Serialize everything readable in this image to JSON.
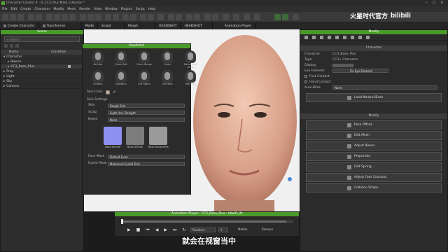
{
  "app": {
    "title": "Character Creator 4 - R_CC3_Plus Male.ccAvatar *"
  },
  "menu": [
    "File",
    "Edit",
    "Create",
    "Character",
    "Modify",
    "Mesh",
    "Render",
    "View",
    "Window",
    "Plugins",
    "Script",
    "Help"
  ],
  "subbar": {
    "create_character": "Create Character",
    "transformer": "Transformer",
    "mode": "Mode",
    "sculpt": "Sculpt",
    "morph": "Morph",
    "headshot": "HEADSHOT",
    "headshot2": "HEADSHOT",
    "animation_player": "Animation Player"
  },
  "scene": {
    "title": "Scene",
    "search_placeholder": "Search",
    "col_name": "Name",
    "col_condition": "Condition",
    "items": [
      {
        "label": "Character"
      },
      {
        "label": "Bakers"
      },
      {
        "label": "CC3_Base_Plus"
      },
      {
        "label": "Prop"
      },
      {
        "label": "Light"
      },
      {
        "label": "Sky"
      },
      {
        "label": "Camera"
      }
    ]
  },
  "headshot": {
    "title": "Headshot",
    "heads": [
      "No Hair",
      "Clean Soft",
      "Clean Rough",
      "Scalp",
      "Beard and Scalp",
      "Contour",
      "Sideburn",
      "Old Faded",
      "Old Male",
      "Very Old"
    ],
    "skin_color_label": "Skin Color",
    "skin_settings_label": "Skin Settings",
    "skin_label": "Skin",
    "skin_value": "Rough Skin",
    "scalp_label": "Scalp",
    "scalp_value": "Light Hair Straight",
    "beard_label": "Beard",
    "beard_value": "None",
    "maps": [
      "Base Normal",
      "Base Diffuse",
      "Base Roughness"
    ],
    "face_mask_label": "Face Mask",
    "face_mask_value": "Default Even",
    "eyelid_mask_label": "Eyelid Mask",
    "eyelid_mask_value": "Maximum Eyelid Trim"
  },
  "modify": {
    "title": "Modify",
    "section_character": "Character",
    "character_label": "Character",
    "character_value": "CC3_Base_Plus",
    "type_label": "Type",
    "type_value": "CC3+ Character",
    "display_label": "Display",
    "eye_element_label": "Eye Element",
    "eye_element_value": "Fix Eye Element",
    "foot_contact": "Foot Contact",
    "hand_contact": "Hand Contact",
    "auto_bake_label": "Auto-Blink",
    "auto_bake_value": "None",
    "load_neutral": "Load Neutral Base",
    "section_modify": "Modify",
    "buttons": [
      "Pose Offset",
      "Edit Mesh",
      "Adjust Bones",
      "Proportion",
      "Edit Spring",
      "Adjust Foot Contacts",
      "Collision Shape"
    ]
  },
  "anim": {
    "title": "Animation Player - CC3_Base_Plus - Idle01_M",
    "realtime": "Realtime",
    "motion": "Motion",
    "remove": "Remove",
    "frame": "1"
  },
  "watermark": {
    "channel": "火星时代官方",
    "logo": "bilibili"
  },
  "subtitle": "就会在视窗当中"
}
